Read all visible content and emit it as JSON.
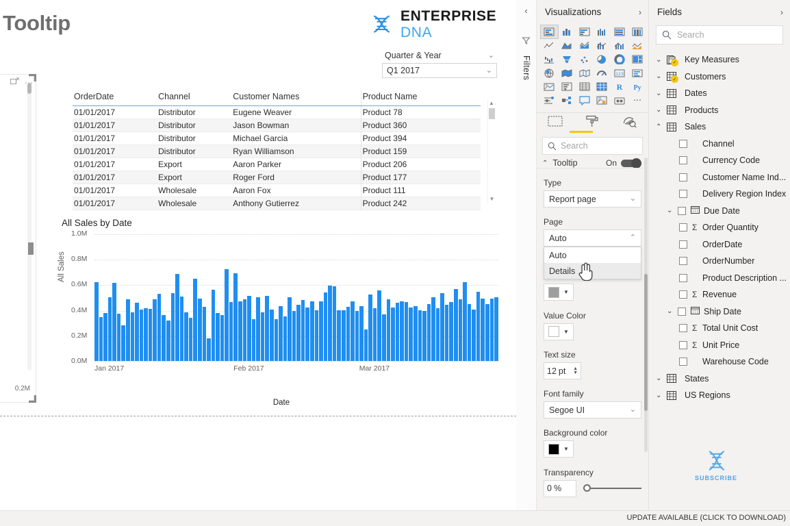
{
  "canvas": {
    "page_title": "Tooltip",
    "brand": {
      "enterprise": "ENTERPRISE",
      "dna": "DNA",
      "logo_icon": "dna-helix-icon"
    },
    "slicer": {
      "label": "Quarter & Year",
      "value": "Q1 2017"
    },
    "left_visual": {
      "axis_value": "0.2M",
      "focus_icon": "focus-mode-icon",
      "more_icon": "more-options-icon"
    }
  },
  "table_visual": {
    "columns": [
      "OrderDate",
      "Channel",
      "Customer Names",
      "Product Name"
    ],
    "rows": [
      [
        "01/01/2017",
        "Distributor",
        "Eugene Weaver",
        "Product 78"
      ],
      [
        "01/01/2017",
        "Distributor",
        "Jason Bowman",
        "Product 360"
      ],
      [
        "01/01/2017",
        "Distributor",
        "Michael Garcia",
        "Product 394"
      ],
      [
        "01/01/2017",
        "Distributor",
        "Ryan Williamson",
        "Product 159"
      ],
      [
        "01/01/2017",
        "Export",
        "Aaron Parker",
        "Product 206"
      ],
      [
        "01/01/2017",
        "Export",
        "Roger Ford",
        "Product 177"
      ],
      [
        "01/01/2017",
        "Wholesale",
        "Aaron Fox",
        "Product 111"
      ],
      [
        "01/01/2017",
        "Wholesale",
        "Anthony Gutierrez",
        "Product 242"
      ]
    ]
  },
  "chart_data": {
    "type": "bar",
    "title": "All Sales by Date",
    "xlabel": "Date",
    "ylabel": "All Sales",
    "ylim": [
      0,
      1000000
    ],
    "ytick_labels": [
      "1.0M",
      "0.8M",
      "0.6M",
      "0.4M",
      "0.2M",
      "0.0M"
    ],
    "ytick_values": [
      1000000,
      800000,
      600000,
      400000,
      200000,
      0
    ],
    "xtick_labels": [
      "Jan 2017",
      "Feb 2017",
      "Mar 2017"
    ],
    "grid": true,
    "legend": "none",
    "bar_color": "#1f8ef1",
    "categories": [
      "01 Jan 2017",
      "02 Jan 2017",
      "03 Jan 2017",
      "04 Jan 2017",
      "05 Jan 2017",
      "06 Jan 2017",
      "07 Jan 2017",
      "08 Jan 2017",
      "09 Jan 2017",
      "10 Jan 2017",
      "11 Jan 2017",
      "12 Jan 2017",
      "13 Jan 2017",
      "14 Jan 2017",
      "15 Jan 2017",
      "16 Jan 2017",
      "17 Jan 2017",
      "18 Jan 2017",
      "19 Jan 2017",
      "20 Jan 2017",
      "21 Jan 2017",
      "22 Jan 2017",
      "23 Jan 2017",
      "24 Jan 2017",
      "25 Jan 2017",
      "26 Jan 2017",
      "27 Jan 2017",
      "28 Jan 2017",
      "29 Jan 2017",
      "30 Jan 2017",
      "31 Jan 2017",
      "01 Feb 2017",
      "02 Feb 2017",
      "03 Feb 2017",
      "04 Feb 2017",
      "05 Feb 2017",
      "06 Feb 2017",
      "07 Feb 2017",
      "08 Feb 2017",
      "09 Feb 2017",
      "10 Feb 2017",
      "11 Feb 2017",
      "12 Feb 2017",
      "13 Feb 2017",
      "14 Feb 2017",
      "15 Feb 2017",
      "16 Feb 2017",
      "17 Feb 2017",
      "18 Feb 2017",
      "19 Feb 2017",
      "20 Feb 2017",
      "21 Feb 2017",
      "22 Feb 2017",
      "23 Feb 2017",
      "24 Feb 2017",
      "25 Feb 2017",
      "26 Feb 2017",
      "27 Feb 2017",
      "28 Feb 2017",
      "01 Mar 2017",
      "02 Mar 2017",
      "03 Mar 2017",
      "04 Mar 2017",
      "05 Mar 2017",
      "06 Mar 2017",
      "07 Mar 2017",
      "08 Mar 2017",
      "09 Mar 2017",
      "10 Mar 2017",
      "11 Mar 2017",
      "12 Mar 2017",
      "13 Mar 2017",
      "14 Mar 2017",
      "15 Mar 2017",
      "16 Mar 2017",
      "17 Mar 2017",
      "18 Mar 2017",
      "19 Mar 2017",
      "20 Mar 2017",
      "21 Mar 2017",
      "22 Mar 2017",
      "23 Mar 2017",
      "24 Mar 2017",
      "25 Mar 2017",
      "26 Mar 2017",
      "27 Mar 2017",
      "28 Mar 2017",
      "29 Mar 2017",
      "30 Mar 2017",
      "31 Mar 2017"
    ],
    "values": [
      620000,
      345000,
      375000,
      500000,
      615000,
      370000,
      280000,
      485000,
      382000,
      455000,
      405000,
      412000,
      410000,
      485000,
      528000,
      358000,
      315000,
      535000,
      685000,
      508000,
      382000,
      340000,
      645000,
      487000,
      425000,
      178000,
      558000,
      378000,
      358000,
      718000,
      465000,
      690000,
      467000,
      485000,
      512000,
      328000,
      500000,
      380000,
      510000,
      402000,
      330000,
      430000,
      352000,
      500000,
      392000,
      440000,
      478000,
      420000,
      470000,
      400000,
      470000,
      540000,
      590000,
      585000,
      398000,
      400000,
      425000,
      468000,
      395000,
      430000,
      250000,
      520000,
      415000,
      555000,
      368000,
      485000,
      420000,
      455000,
      470000,
      462000,
      418000,
      430000,
      398000,
      392000,
      448000,
      500000,
      412000,
      530000,
      440000,
      462000,
      562000,
      482000,
      620000,
      448000,
      405000,
      545000,
      490000,
      445000,
      488000,
      500000
    ]
  },
  "filters_rail": {
    "label": "Filters",
    "collapse_icon": "chevron-left-icon",
    "funnel_icon": "filter-funnel-icon"
  },
  "visualizations": {
    "title": "Visualizations",
    "expand_icon": "chevron-right-icon",
    "icons": [
      "stacked-bar-chart-icon",
      "stacked-column-chart-icon",
      "clustered-bar-chart-icon",
      "clustered-column-chart-icon",
      "hundred-percent-stacked-bar-icon",
      "hundred-percent-stacked-column-icon",
      "line-chart-icon",
      "area-chart-icon",
      "stacked-area-chart-icon",
      "line-stacked-column-icon",
      "line-clustered-column-icon",
      "ribbon-chart-icon",
      "waterfall-chart-icon",
      "funnel-chart-icon",
      "scatter-chart-icon",
      "pie-chart-icon",
      "donut-chart-icon",
      "treemap-icon",
      "map-icon",
      "filled-map-icon",
      "shape-map-icon",
      "gauge-icon",
      "card-icon",
      "multi-row-card-icon",
      "kpi-icon",
      "slicer-icon",
      "table-icon",
      "matrix-icon",
      "r-script-visual-icon",
      "python-visual-icon",
      "key-influencers-icon",
      "decomposition-tree-icon",
      "qa-visual-icon",
      "smart-narrative-icon",
      "paginated-report-icon",
      "more-visuals-icon"
    ],
    "tabs": [
      "fields-tab-icon",
      "format-tab-icon",
      "analytics-tab-icon"
    ],
    "active_tab": "format-tab-icon",
    "search_placeholder": "Search",
    "format": {
      "section": "Tooltip",
      "section_state": "On",
      "type_label": "Type",
      "type_value": "Report page",
      "page_label": "Page",
      "page_value": "Auto",
      "page_options": [
        "Auto",
        "Details"
      ],
      "page_hovered_option": "Details",
      "value_color_label": "Value Color",
      "text_size_label": "Text size",
      "text_size_value": "12",
      "text_size_unit": "pt",
      "font_family_label": "Font family",
      "font_family_value": "Segoe UI",
      "background_color_label": "Background color",
      "background_color_value": "#000000",
      "transparency_label": "Transparency",
      "transparency_value": "0",
      "transparency_unit": "%"
    }
  },
  "fields": {
    "title": "Fields",
    "expand_icon": "chevron-right-icon",
    "search_placeholder": "Search",
    "tables": [
      {
        "name": "Key Measures",
        "expanded": false,
        "icon": "measure-table-icon",
        "badge": true
      },
      {
        "name": "Customers",
        "expanded": false,
        "icon": "table-icon",
        "badge": true
      },
      {
        "name": "Dates",
        "expanded": false,
        "icon": "table-icon",
        "badge": false
      },
      {
        "name": "Products",
        "expanded": false,
        "icon": "table-icon",
        "badge": false
      },
      {
        "name": "Sales",
        "expanded": true,
        "icon": "table-icon",
        "badge": false
      }
    ],
    "sales_fields": [
      {
        "name": "Channel",
        "type": "text",
        "checked": false
      },
      {
        "name": "Currency Code",
        "type": "text",
        "checked": false
      },
      {
        "name": "Customer Name Ind...",
        "type": "text",
        "checked": false
      },
      {
        "name": "Delivery Region Index",
        "type": "text",
        "checked": false
      },
      {
        "name": "Due Date",
        "type": "date-hierarchy",
        "checked": false
      },
      {
        "name": "Order Quantity",
        "type": "sum",
        "checked": false
      },
      {
        "name": "OrderDate",
        "type": "text",
        "checked": false
      },
      {
        "name": "OrderNumber",
        "type": "text",
        "checked": false
      },
      {
        "name": "Product Description ...",
        "type": "text",
        "checked": false
      },
      {
        "name": "Revenue",
        "type": "sum",
        "checked": false
      },
      {
        "name": "Ship Date",
        "type": "date-hierarchy",
        "checked": false
      },
      {
        "name": "Total Unit Cost",
        "type": "sum",
        "checked": false
      },
      {
        "name": "Unit Price",
        "type": "sum",
        "checked": false
      },
      {
        "name": "Warehouse Code",
        "type": "text",
        "checked": false
      }
    ],
    "tables_after": [
      {
        "name": "States",
        "expanded": false,
        "icon": "table-icon",
        "badge": false
      },
      {
        "name": "US Regions",
        "expanded": false,
        "icon": "table-icon",
        "badge": false
      }
    ],
    "subscribe_text": "SUBSCRIBE"
  },
  "statusbar": {
    "message": "UPDATE AVAILABLE (CLICK TO DOWNLOAD)"
  }
}
